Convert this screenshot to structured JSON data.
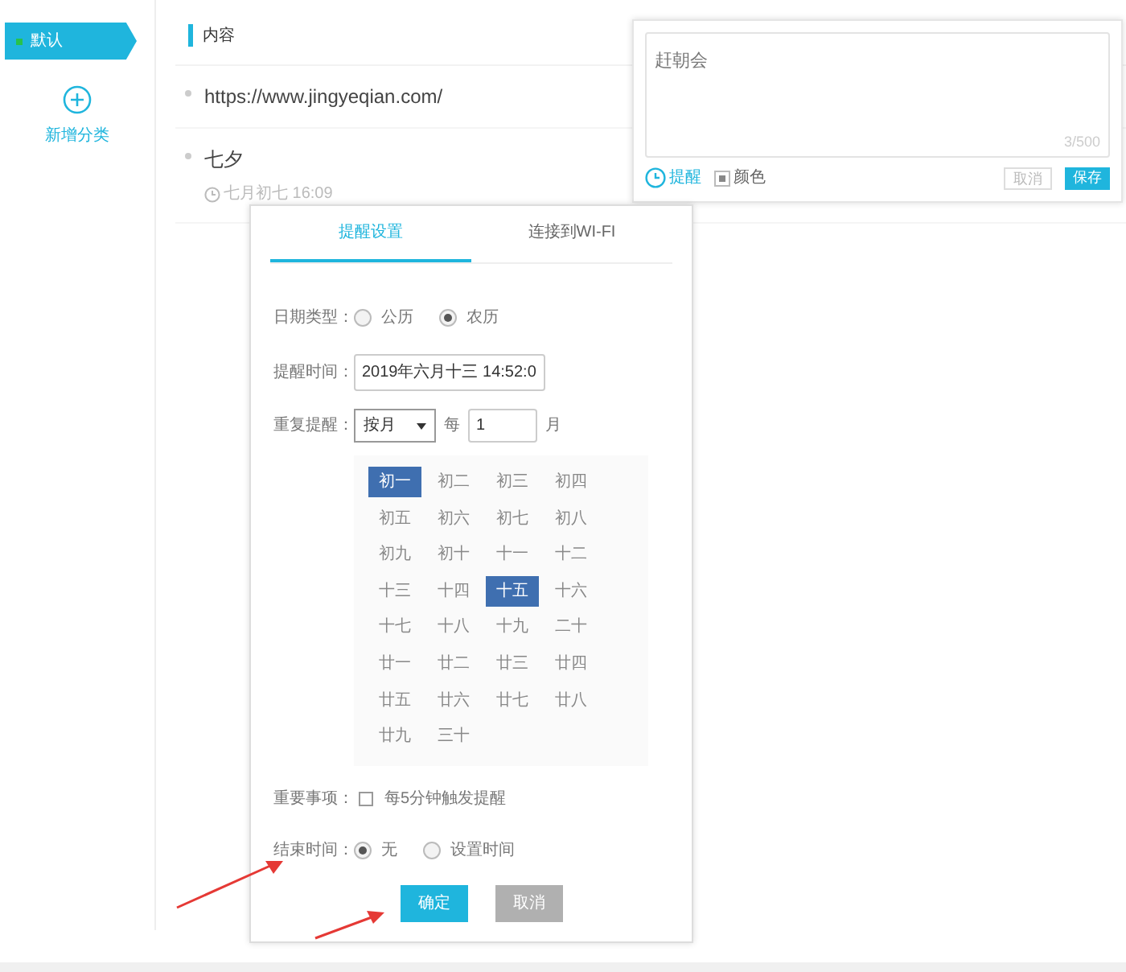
{
  "sidebar": {
    "items": [
      {
        "label": "默认",
        "selected": true
      }
    ],
    "add_button": "新增分类"
  },
  "content": {
    "header": "内容",
    "items": [
      {
        "text": "https://www.jingyeqian.com/"
      },
      {
        "text": "七夕",
        "time": "七月初七 16:09"
      }
    ]
  },
  "editor": {
    "value": "赶朝会",
    "counter": "3/500",
    "tools": [
      {
        "kind": "clock",
        "label": "提醒",
        "selected": true
      },
      {
        "kind": "color",
        "label": "颜色",
        "selected": false
      }
    ],
    "buttons": [
      {
        "label": "取消",
        "kind": "secondary"
      },
      {
        "label": "保存",
        "kind": "primary"
      }
    ]
  },
  "reminder": {
    "tabs": [
      {
        "label": "提醒设置",
        "selected": true
      },
      {
        "label": "连接到WI-FI",
        "selected": false
      }
    ],
    "date_type": {
      "label": "日期类型：",
      "options": [
        {
          "label": "公历",
          "selected": false
        },
        {
          "label": "农历",
          "selected": true
        }
      ]
    },
    "time": {
      "label": "提醒时间：",
      "value": "2019年六月十三 14:52:0"
    },
    "repeat": {
      "label": "重复提醒：",
      "select": "按月",
      "every": "每",
      "count": "1",
      "unit": "月"
    },
    "days": [
      {
        "label": "初一",
        "selected": true
      },
      {
        "label": "初二",
        "selected": false
      },
      {
        "label": "初三",
        "selected": false
      },
      {
        "label": "初四",
        "selected": false
      },
      {
        "label": "初五",
        "selected": false
      },
      {
        "label": "初六",
        "selected": false
      },
      {
        "label": "初七",
        "selected": false
      },
      {
        "label": "初八",
        "selected": false
      },
      {
        "label": "初九",
        "selected": false
      },
      {
        "label": "初十",
        "selected": false
      },
      {
        "label": "十一",
        "selected": false
      },
      {
        "label": "十二",
        "selected": false
      },
      {
        "label": "十三",
        "selected": false
      },
      {
        "label": "十四",
        "selected": false
      },
      {
        "label": "十五",
        "selected": true
      },
      {
        "label": "十六",
        "selected": false
      },
      {
        "label": "十七",
        "selected": false
      },
      {
        "label": "十八",
        "selected": false
      },
      {
        "label": "十九",
        "selected": false
      },
      {
        "label": "二十",
        "selected": false
      },
      {
        "label": "廿一",
        "selected": false
      },
      {
        "label": "廿二",
        "selected": false
      },
      {
        "label": "廿三",
        "selected": false
      },
      {
        "label": "廿四",
        "selected": false
      },
      {
        "label": "廿五",
        "selected": false
      },
      {
        "label": "廿六",
        "selected": false
      },
      {
        "label": "廿七",
        "selected": false
      },
      {
        "label": "廿八",
        "selected": false
      },
      {
        "label": "廿九",
        "selected": false
      },
      {
        "label": "三十",
        "selected": false
      }
    ],
    "important": {
      "label": "重要事项：",
      "option": "每5分钟触发提醒",
      "checked": false
    },
    "end": {
      "label": "结束时间：",
      "options": [
        {
          "label": "无",
          "selected": true
        },
        {
          "label": "设置时间",
          "selected": false
        }
      ]
    },
    "buttons": [
      {
        "label": "确定",
        "kind": "primary"
      },
      {
        "label": "取消",
        "kind": "secondary"
      }
    ]
  }
}
